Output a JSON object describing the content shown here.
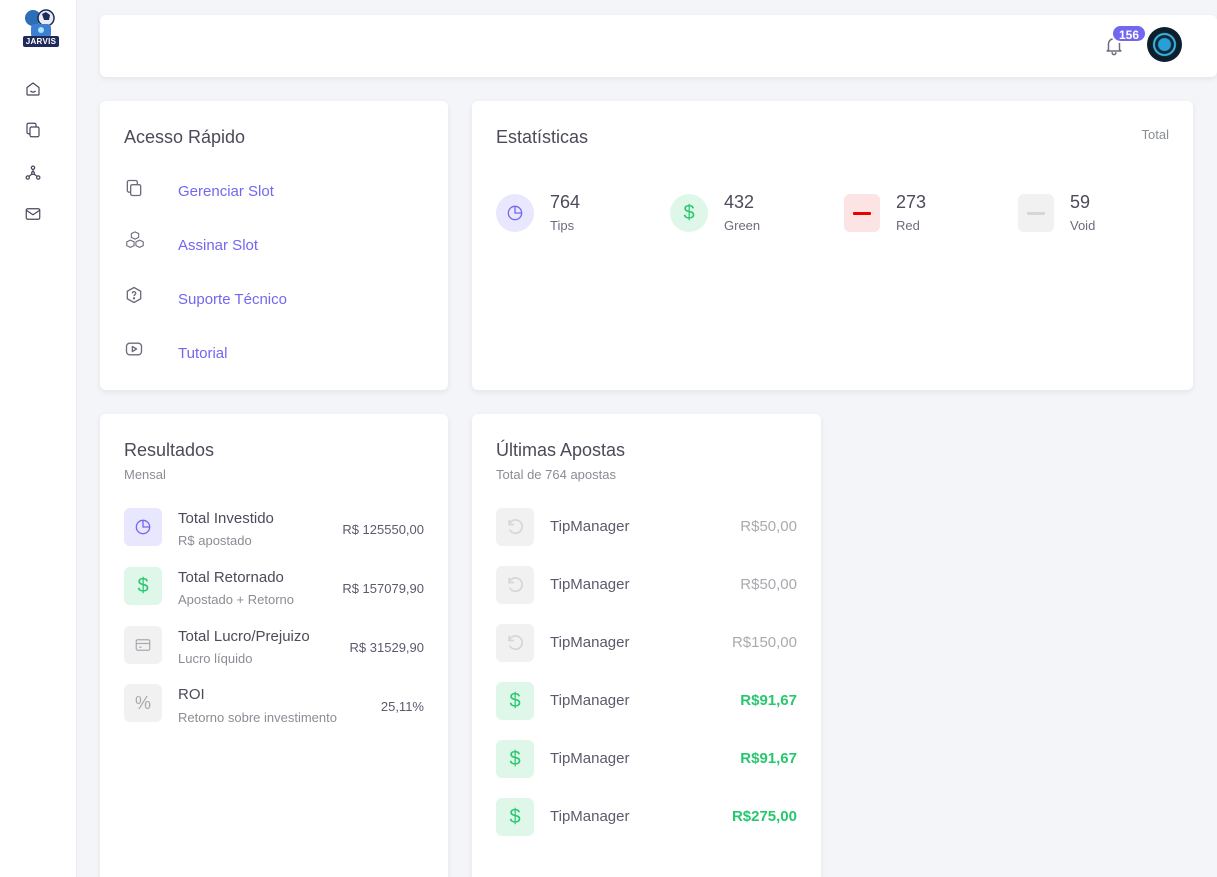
{
  "app": {
    "logo_text": "JARVIS"
  },
  "sidebar": {
    "items": [
      {
        "icon": "home-icon"
      },
      {
        "icon": "copy-icon"
      },
      {
        "icon": "network-icon"
      },
      {
        "icon": "mail-icon"
      }
    ]
  },
  "topbar": {
    "notification_count": "156"
  },
  "quick_access": {
    "title": "Acesso Rápido",
    "items": [
      {
        "label": "Gerenciar Slot",
        "icon": "copy-icon"
      },
      {
        "label": "Assinar Slot",
        "icon": "boxes-icon"
      },
      {
        "label": "Suporte Técnico",
        "icon": "help-hexagon-icon"
      },
      {
        "label": "Tutorial",
        "icon": "video-icon"
      }
    ]
  },
  "stats": {
    "title": "Estatísticas",
    "period": "Total",
    "items": [
      {
        "value": "764",
        "label": "Tips",
        "color": "#7367f0"
      },
      {
        "value": "432",
        "label": "Green",
        "color": "#28c76f"
      },
      {
        "value": "273",
        "label": "Red",
        "color": "#ea5455"
      },
      {
        "value": "59",
        "label": "Void",
        "color": "#c4c4c8"
      }
    ]
  },
  "results": {
    "title": "Resultados",
    "subtitle": "Mensal",
    "items": [
      {
        "title": "Total Investido",
        "sub": "R$ apostado",
        "value": "R$ 125550,00"
      },
      {
        "title": "Total Retornado",
        "sub": "Apostado + Retorno",
        "value": "R$ 157079,90"
      },
      {
        "title": "Total Lucro/Prejuizo",
        "sub": "Lucro líquido",
        "value": "R$ 31529,90"
      },
      {
        "title": "ROI",
        "sub": "Retorno sobre investimento",
        "value": "25,11%",
        "icon_text": "%"
      }
    ]
  },
  "bets": {
    "title": "Últimas Apostas",
    "subtitle": "Total de 764 apostas",
    "items": [
      {
        "name": "TipManager",
        "value": "R$50,00",
        "status": "void"
      },
      {
        "name": "TipManager",
        "value": "R$50,00",
        "status": "void"
      },
      {
        "name": "TipManager",
        "value": "R$150,00",
        "status": "void"
      },
      {
        "name": "TipManager",
        "value": "R$91,67",
        "status": "green"
      },
      {
        "name": "TipManager",
        "value": "R$91,67",
        "status": "green"
      },
      {
        "name": "TipManager",
        "value": "R$275,00",
        "status": "green"
      }
    ]
  },
  "colors": {
    "accent": "#7367f0",
    "green": "#28c76f",
    "red": "#ea5455",
    "void": "#a8aaae"
  }
}
